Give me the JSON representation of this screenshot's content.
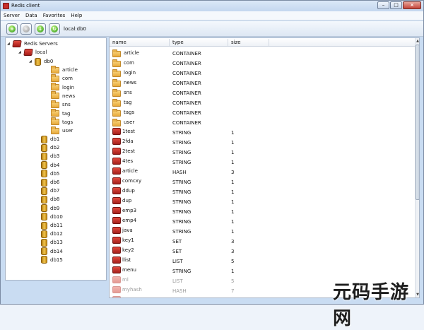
{
  "window": {
    "title": "Redis client"
  },
  "menu": [
    "Server",
    "Data",
    "Favorites",
    "Help"
  ],
  "toolbar": {
    "path": "local:db0"
  },
  "tree": {
    "root": "Redis Servers",
    "server": "local",
    "selected_db": "db0",
    "db0_children": [
      "article",
      "com",
      "login",
      "news",
      "sns",
      "tag",
      "tags",
      "user"
    ],
    "other_dbs": [
      "db1",
      "db2",
      "db3",
      "db4",
      "db5",
      "db6",
      "db7",
      "db8",
      "db9",
      "db10",
      "db11",
      "db12",
      "db13",
      "db14",
      "db15"
    ]
  },
  "grid": {
    "columns": [
      "name",
      "type",
      "size"
    ],
    "rows": [
      {
        "name": "article",
        "type": "CONTAINER",
        "size": "",
        "icon": "folder-icon"
      },
      {
        "name": "com",
        "type": "CONTAINER",
        "size": "",
        "icon": "folder-icon"
      },
      {
        "name": "login",
        "type": "CONTAINER",
        "size": "",
        "icon": "folder-icon"
      },
      {
        "name": "news",
        "type": "CONTAINER",
        "size": "",
        "icon": "folder-icon"
      },
      {
        "name": "sns",
        "type": "CONTAINER",
        "size": "",
        "icon": "folder-icon"
      },
      {
        "name": "tag",
        "type": "CONTAINER",
        "size": "",
        "icon": "folder-icon"
      },
      {
        "name": "tags",
        "type": "CONTAINER",
        "size": "",
        "icon": "folder-icon"
      },
      {
        "name": "user",
        "type": "CONTAINER",
        "size": "",
        "icon": "folder-icon"
      },
      {
        "name": "1test",
        "type": "STRING",
        "size": "1",
        "icon": "redis-key-icon"
      },
      {
        "name": "2fda",
        "type": "STRING",
        "size": "1",
        "icon": "redis-key-icon"
      },
      {
        "name": "2test",
        "type": "STRING",
        "size": "1",
        "icon": "redis-key-icon"
      },
      {
        "name": "4tes",
        "type": "STRING",
        "size": "1",
        "icon": "redis-key-icon"
      },
      {
        "name": "article",
        "type": "HASH",
        "size": "3",
        "icon": "redis-key-icon"
      },
      {
        "name": "comcxy",
        "type": "STRING",
        "size": "1",
        "icon": "redis-key-icon"
      },
      {
        "name": "ddup",
        "type": "STRING",
        "size": "1",
        "icon": "redis-key-icon"
      },
      {
        "name": "dup",
        "type": "STRING",
        "size": "1",
        "icon": "redis-key-icon"
      },
      {
        "name": "emp3",
        "type": "STRING",
        "size": "1",
        "icon": "redis-key-icon"
      },
      {
        "name": "emp4",
        "type": "STRING",
        "size": "1",
        "icon": "redis-key-icon"
      },
      {
        "name": "java",
        "type": "STRING",
        "size": "1",
        "icon": "redis-key-icon"
      },
      {
        "name": "key1",
        "type": "SET",
        "size": "3",
        "icon": "redis-key-icon"
      },
      {
        "name": "key2",
        "type": "SET",
        "size": "3",
        "icon": "redis-key-icon"
      },
      {
        "name": "llist",
        "type": "LIST",
        "size": "5",
        "icon": "redis-key-icon"
      },
      {
        "name": "menu",
        "type": "STRING",
        "size": "1",
        "icon": "redis-key-icon"
      },
      {
        "name": "ml",
        "type": "LIST",
        "size": "5",
        "icon": "redis-key-icon",
        "faded": true
      },
      {
        "name": "myhash",
        "type": "HASH",
        "size": "7",
        "icon": "redis-key-icon",
        "faded": true
      },
      {
        "name": "myset",
        "type": "STRING",
        "size": "1",
        "icon": "redis-key-icon",
        "faded": true
      }
    ]
  },
  "watermark": "元码手游网"
}
